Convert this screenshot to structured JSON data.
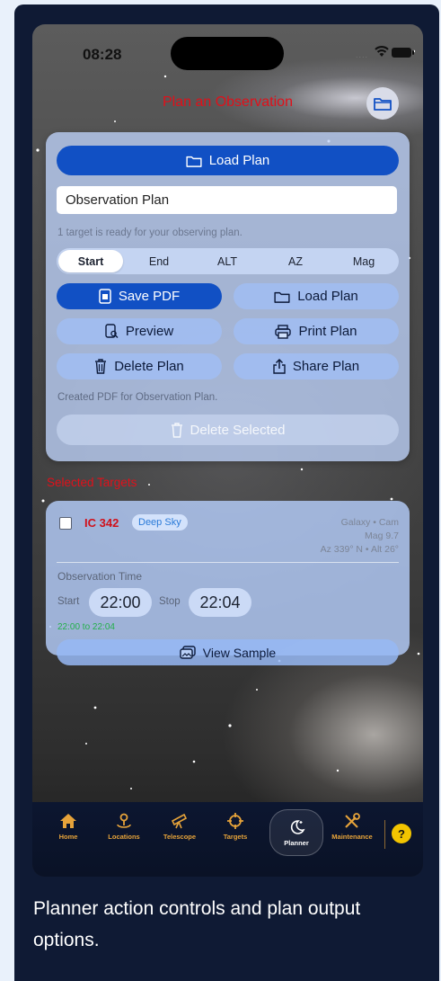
{
  "status": {
    "time": "08:28"
  },
  "header": {
    "title": "Plan an Observation",
    "folder_icon": "folder-icon"
  },
  "plan_panel": {
    "load_plan_main": "Load Plan",
    "plan_name_value": "Observation Plan",
    "ready_text": "1 target is ready for your observing plan.",
    "sort_options": [
      "Start",
      "End",
      "ALT",
      "AZ",
      "Mag"
    ],
    "selected_sort": "Start",
    "actions": {
      "save_pdf": "Save PDF",
      "load_plan": "Load Plan",
      "preview": "Preview",
      "print_plan": "Print Plan",
      "delete_plan": "Delete Plan",
      "share_plan": "Share Plan"
    },
    "created_text": "Created PDF for Observation Plan.",
    "delete_selected": "Delete Selected"
  },
  "selected_targets": {
    "title": "Selected Targets",
    "target": {
      "name": "IC 342",
      "tag": "Deep Sky",
      "info_type": "Galaxy • Cam",
      "info_mag": "Mag 9.7",
      "info_pos": "Az 339° N • Alt 26°",
      "obs_time_label": "Observation Time",
      "start_label": "Start",
      "start_time": "22:00",
      "stop_label": "Stop",
      "stop_time": "22:04",
      "range": "22:00 to 22:04",
      "view_sample": "View Sample"
    }
  },
  "tabbar": {
    "tabs": [
      {
        "label": "Home",
        "icon": "home-icon"
      },
      {
        "label": "Locations",
        "icon": "location-pin-icon"
      },
      {
        "label": "Telescope",
        "icon": "telescope-icon"
      },
      {
        "label": "Targets",
        "icon": "crosshair-icon"
      },
      {
        "label": "Planner",
        "icon": "moon-icon"
      },
      {
        "label": "Maintenance",
        "icon": "tools-icon"
      }
    ],
    "active_tab": "Planner",
    "help": "?"
  },
  "caption": "Planner action controls and plan output options.",
  "colors": {
    "accent": "#1150c4",
    "title_red": "#e0101a",
    "tab_gold": "#e6a33a",
    "help_yellow": "#f2c400"
  }
}
